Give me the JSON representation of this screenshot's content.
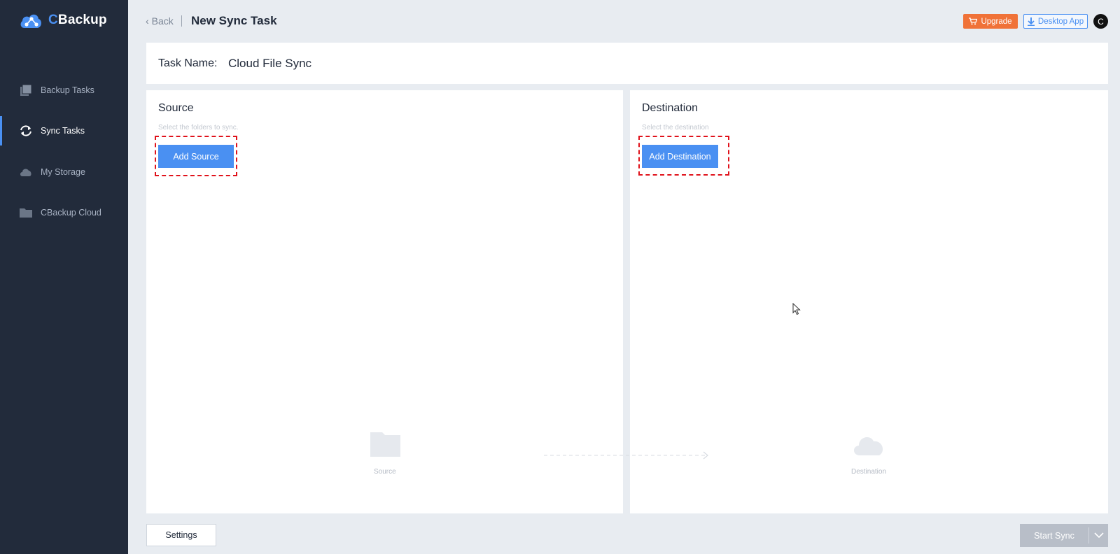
{
  "app": {
    "logo_prefix": "C",
    "logo_suffix": "Backup",
    "brand_color": "#4a90f2",
    "sidebar_bg": "#222b3b"
  },
  "sidebar": {
    "items": [
      {
        "label": "Backup Tasks",
        "icon": "backup-tasks-icon",
        "active": false
      },
      {
        "label": "Sync Tasks",
        "icon": "sync-icon",
        "active": true
      },
      {
        "label": "My Storage",
        "icon": "cloud-icon",
        "active": false
      },
      {
        "label": "CBackup Cloud",
        "icon": "folder-icon",
        "active": false
      }
    ]
  },
  "header": {
    "back_label": "Back",
    "title": "New Sync Task",
    "upgrade_label": "Upgrade",
    "desktop_app_label": "Desktop App",
    "avatar_letter": "C",
    "upgrade_color": "#f07238"
  },
  "task": {
    "label": "Task Name:",
    "value": "Cloud File Sync"
  },
  "source": {
    "title": "Source",
    "hint": "Select the folders to sync.",
    "button": "Add Source",
    "placeholder_label": "Source"
  },
  "destination": {
    "title": "Destination",
    "hint": "Select the destination",
    "button": "Add Destination",
    "placeholder_label": "Destination"
  },
  "footer": {
    "settings_label": "Settings",
    "start_label": "Start Sync"
  },
  "highlight_color": "#e0121b"
}
